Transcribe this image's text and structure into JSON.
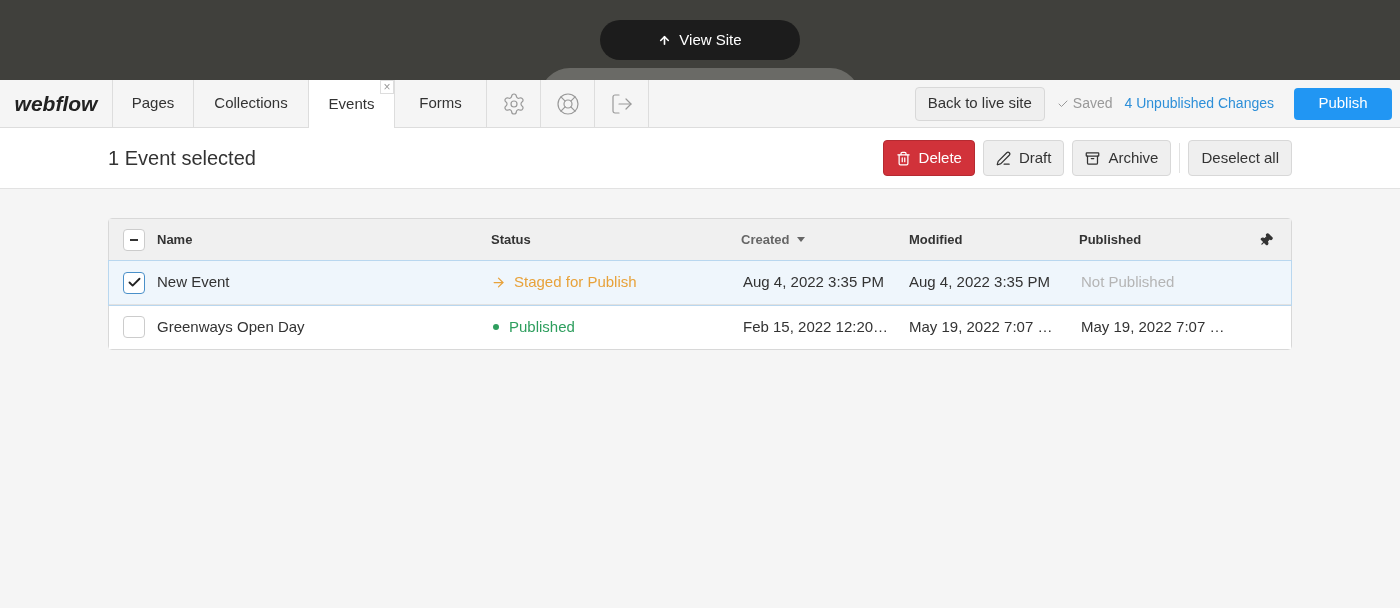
{
  "preview": {
    "view_site_button": "View Site"
  },
  "toolbar": {
    "logo": "webflow",
    "tabs": [
      {
        "label": "Pages",
        "selected": false
      },
      {
        "label": "Collections",
        "selected": false
      },
      {
        "label": "Events",
        "selected": true,
        "close": "×"
      },
      {
        "label": "Forms",
        "selected": false
      }
    ],
    "icon_tabs": [
      {
        "kind": "settings"
      },
      {
        "kind": "help"
      },
      {
        "kind": "exit"
      }
    ],
    "back_button": "Back to live site",
    "saved": "Saved",
    "unpublished_link": "4 Unpublished Changes",
    "publish_button": "Publish"
  },
  "action_bar": {
    "title": "1 Event selected",
    "buttons": [
      {
        "kind": "delete",
        "label": "Delete"
      },
      {
        "kind": "draft",
        "label": "Draft"
      },
      {
        "kind": "archive",
        "label": "Archive"
      },
      {
        "kind": "deselect",
        "label": "Deselect all"
      }
    ]
  },
  "table": {
    "select_all": {
      "indeterminate": true
    },
    "columns": [
      {
        "label": "Name"
      },
      {
        "label": "Status"
      },
      {
        "label": "Created",
        "sorted": true
      },
      {
        "label": "Modified"
      },
      {
        "label": "Published"
      }
    ],
    "rows": [
      {
        "selected": true,
        "name": "New Event",
        "status": {
          "kind": "staged",
          "label": "Staged for Publish"
        },
        "created": "Aug 4, 2022 3:35 PM",
        "modified": "Aug 4, 2022 3:35 PM",
        "published": {
          "kind": "none",
          "label": "Not Published"
        }
      },
      {
        "selected": false,
        "name": "Greenways Open Day",
        "status": {
          "kind": "published",
          "label": "Published"
        },
        "created": "Feb 15, 2022 12:20…",
        "modified": "May 19, 2022 7:07 …",
        "published": {
          "kind": "date",
          "label": "May 19, 2022 7:07 …"
        }
      }
    ]
  }
}
